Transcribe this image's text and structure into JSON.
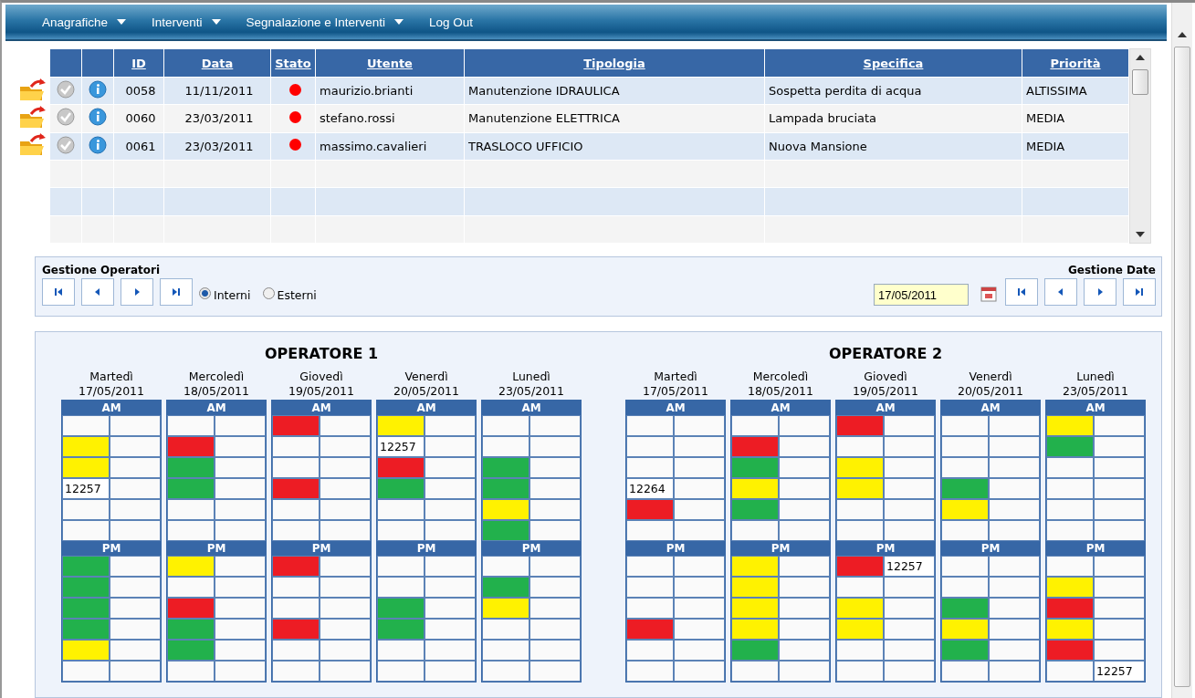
{
  "menu": [
    {
      "label": "Anagrafiche",
      "has_menu": true
    },
    {
      "label": "Interventi",
      "has_menu": true
    },
    {
      "label": "Segnalazione e Interventi",
      "has_menu": true
    },
    {
      "label": "Log Out",
      "has_menu": false
    }
  ],
  "table": {
    "columns": [
      "ID",
      "Data",
      "Stato",
      "Utente",
      "Tipologia",
      "Specifica",
      "Priorità"
    ],
    "rows": [
      {
        "id": "0058",
        "data": "11/11/2011",
        "color": "#ff0000",
        "utente": "maurizio.brianti",
        "tipologia": "Manutenzione IDRAULICA",
        "specifica": "Sospetta perdita di acqua",
        "priorita": "ALTISSIMA"
      },
      {
        "id": "0060",
        "data": "23/03/2011",
        "color": "#ff0000",
        "utente": "stefano.rossi",
        "tipologia": "Manutenzione ELETTRICA",
        "specifica": "Lampada bruciata",
        "priorita": "MEDIA"
      },
      {
        "id": "0061",
        "data": "23/03/2011",
        "color": "#ff0000",
        "utente": "massimo.cavalieri",
        "tipologia": "TRASLOCO UFFICIO",
        "specifica": "Nuova Mansione",
        "priorita": "MEDIA"
      }
    ]
  },
  "operator_controls": {
    "title": "Gestione Operatori",
    "options": [
      {
        "label": "Interni",
        "selected": true
      },
      {
        "label": "Esterni",
        "selected": false
      }
    ]
  },
  "date_controls": {
    "title": "Gestione Date",
    "date": "17/05/2011"
  },
  "operators": [
    {
      "title": "OPERATORE 1",
      "days": [
        {
          "day": "Martedì",
          "date": "17/05/2011",
          "am": {
            "label": "AM",
            "slots": [
              {
                "kind": "free"
              },
              {
                "kind": "busy",
                "color": "#fff200"
              },
              {
                "kind": "busy",
                "color": "#fff200"
              },
              {
                "kind": "code",
                "left_text": "12257"
              },
              {
                "kind": "free"
              },
              {
                "kind": "free"
              }
            ]
          },
          "pm": {
            "label": "PM",
            "slots": [
              {
                "kind": "busy",
                "color": "#22b14c"
              },
              {
                "kind": "busy",
                "color": "#22b14c"
              },
              {
                "kind": "busy",
                "color": "#22b14c"
              },
              {
                "kind": "busy",
                "color": "#22b14c"
              },
              {
                "kind": "busy",
                "color": "#fff200"
              },
              {
                "kind": "free"
              }
            ]
          }
        },
        {
          "day": "Mercoledì",
          "date": "18/05/2011",
          "am": {
            "label": "AM",
            "slots": [
              {
                "kind": "free"
              },
              {
                "kind": "busy",
                "color": "#ed1c24"
              },
              {
                "kind": "busy",
                "color": "#22b14c"
              },
              {
                "kind": "busy",
                "color": "#22b14c"
              },
              {
                "kind": "free"
              },
              {
                "kind": "free"
              }
            ]
          },
          "pm": {
            "label": "PM",
            "slots": [
              {
                "kind": "busy",
                "color": "#fff200"
              },
              {
                "kind": "free"
              },
              {
                "kind": "busy",
                "color": "#ed1c24"
              },
              {
                "kind": "busy",
                "color": "#22b14c"
              },
              {
                "kind": "busy",
                "color": "#22b14c"
              },
              {
                "kind": "free"
              }
            ]
          }
        },
        {
          "day": "Giovedì",
          "date": "19/05/2011",
          "am": {
            "label": "AM",
            "slots": [
              {
                "kind": "busy",
                "color": "#ed1c24"
              },
              {
                "kind": "free"
              },
              {
                "kind": "free"
              },
              {
                "kind": "busy",
                "color": "#ed1c24"
              },
              {
                "kind": "free"
              },
              {
                "kind": "free"
              }
            ]
          },
          "pm": {
            "label": "PM",
            "slots": [
              {
                "kind": "busy",
                "color": "#ed1c24"
              },
              {
                "kind": "free"
              },
              {
                "kind": "free"
              },
              {
                "kind": "busy",
                "color": "#ed1c24"
              },
              {
                "kind": "free"
              },
              {
                "kind": "free"
              }
            ]
          }
        },
        {
          "day": "Venerdì",
          "date": "20/05/2011",
          "am": {
            "label": "AM",
            "slots": [
              {
                "kind": "busy",
                "color": "#fff200"
              },
              {
                "kind": "code",
                "left_text": "12257"
              },
              {
                "kind": "busy",
                "color": "#ed1c24"
              },
              {
                "kind": "busy",
                "color": "#22b14c"
              },
              {
                "kind": "free"
              },
              {
                "kind": "free"
              }
            ]
          },
          "pm": {
            "label": "PM",
            "slots": [
              {
                "kind": "free"
              },
              {
                "kind": "free"
              },
              {
                "kind": "busy",
                "color": "#22b14c"
              },
              {
                "kind": "busy",
                "color": "#22b14c"
              },
              {
                "kind": "free"
              },
              {
                "kind": "free"
              }
            ]
          }
        },
        {
          "day": "Lunedì",
          "date": "23/05/2011",
          "am": {
            "label": "AM",
            "slots": [
              {
                "kind": "free"
              },
              {
                "kind": "free"
              },
              {
                "kind": "busy",
                "color": "#22b14c"
              },
              {
                "kind": "busy",
                "color": "#22b14c"
              },
              {
                "kind": "busy",
                "color": "#fff200"
              },
              {
                "kind": "busy",
                "color": "#22b14c"
              }
            ]
          },
          "pm": {
            "label": "PM",
            "slots": [
              {
                "kind": "free"
              },
              {
                "kind": "busy",
                "color": "#22b14c"
              },
              {
                "kind": "busy",
                "color": "#fff200"
              },
              {
                "kind": "free"
              },
              {
                "kind": "free"
              },
              {
                "kind": "free"
              }
            ]
          }
        }
      ]
    },
    {
      "title": "OPERATORE 2",
      "days": [
        {
          "day": "Martedì",
          "date": "17/05/2011",
          "am": {
            "label": "AM",
            "slots": [
              {
                "kind": "free"
              },
              {
                "kind": "free"
              },
              {
                "kind": "free"
              },
              {
                "kind": "code",
                "left_text": "12264"
              },
              {
                "kind": "busy",
                "color": "#ed1c24"
              },
              {
                "kind": "free"
              }
            ]
          },
          "pm": {
            "label": "PM",
            "slots": [
              {
                "kind": "free"
              },
              {
                "kind": "free"
              },
              {
                "kind": "free"
              },
              {
                "kind": "busy",
                "color": "#ed1c24"
              },
              {
                "kind": "free"
              },
              {
                "kind": "free"
              }
            ]
          }
        },
        {
          "day": "Mercoledì",
          "date": "18/05/2011",
          "am": {
            "label": "AM",
            "slots": [
              {
                "kind": "free"
              },
              {
                "kind": "busy",
                "color": "#ed1c24"
              },
              {
                "kind": "busy",
                "color": "#22b14c"
              },
              {
                "kind": "busy",
                "color": "#fff200"
              },
              {
                "kind": "busy",
                "color": "#22b14c"
              },
              {
                "kind": "free"
              }
            ]
          },
          "pm": {
            "label": "PM",
            "slots": [
              {
                "kind": "busy",
                "color": "#fff200"
              },
              {
                "kind": "busy",
                "color": "#fff200"
              },
              {
                "kind": "busy",
                "color": "#fff200"
              },
              {
                "kind": "busy",
                "color": "#fff200"
              },
              {
                "kind": "busy",
                "color": "#22b14c"
              },
              {
                "kind": "free"
              }
            ]
          }
        },
        {
          "day": "Giovedì",
          "date": "19/05/2011",
          "am": {
            "label": "AM",
            "slots": [
              {
                "kind": "busy",
                "color": "#ed1c24"
              },
              {
                "kind": "free"
              },
              {
                "kind": "busy",
                "color": "#fff200"
              },
              {
                "kind": "busy",
                "color": "#fff200"
              },
              {
                "kind": "free"
              },
              {
                "kind": "free"
              }
            ]
          },
          "pm": {
            "label": "PM",
            "slots": [
              {
                "kind": "busy",
                "color": "#ed1c24",
                "right_text": "12257"
              },
              {
                "kind": "free"
              },
              {
                "kind": "busy",
                "color": "#fff200"
              },
              {
                "kind": "busy",
                "color": "#fff200"
              },
              {
                "kind": "free"
              },
              {
                "kind": "free"
              }
            ]
          }
        },
        {
          "day": "Venerdì",
          "date": "20/05/2011",
          "am": {
            "label": "AM",
            "slots": [
              {
                "kind": "free"
              },
              {
                "kind": "free"
              },
              {
                "kind": "free"
              },
              {
                "kind": "busy",
                "color": "#22b14c"
              },
              {
                "kind": "busy",
                "color": "#fff200"
              },
              {
                "kind": "free"
              }
            ]
          },
          "pm": {
            "label": "PM",
            "slots": [
              {
                "kind": "free"
              },
              {
                "kind": "free"
              },
              {
                "kind": "busy",
                "color": "#22b14c"
              },
              {
                "kind": "busy",
                "color": "#fff200"
              },
              {
                "kind": "busy",
                "color": "#22b14c"
              },
              {
                "kind": "free"
              }
            ]
          }
        },
        {
          "day": "Lunedì",
          "date": "23/05/2011",
          "am": {
            "label": "AM",
            "slots": [
              {
                "kind": "busy",
                "color": "#fff200"
              },
              {
                "kind": "busy",
                "color": "#22b14c"
              },
              {
                "kind": "free"
              },
              {
                "kind": "free"
              },
              {
                "kind": "free"
              },
              {
                "kind": "free"
              }
            ]
          },
          "pm": {
            "label": "PM",
            "slots": [
              {
                "kind": "free"
              },
              {
                "kind": "busy",
                "color": "#fff200"
              },
              {
                "kind": "busy",
                "color": "#ed1c24"
              },
              {
                "kind": "busy",
                "color": "#fff200"
              },
              {
                "kind": "busy",
                "color": "#ed1c24"
              },
              {
                "kind": "free",
                "right_text": "12257"
              }
            ]
          }
        }
      ]
    }
  ]
}
